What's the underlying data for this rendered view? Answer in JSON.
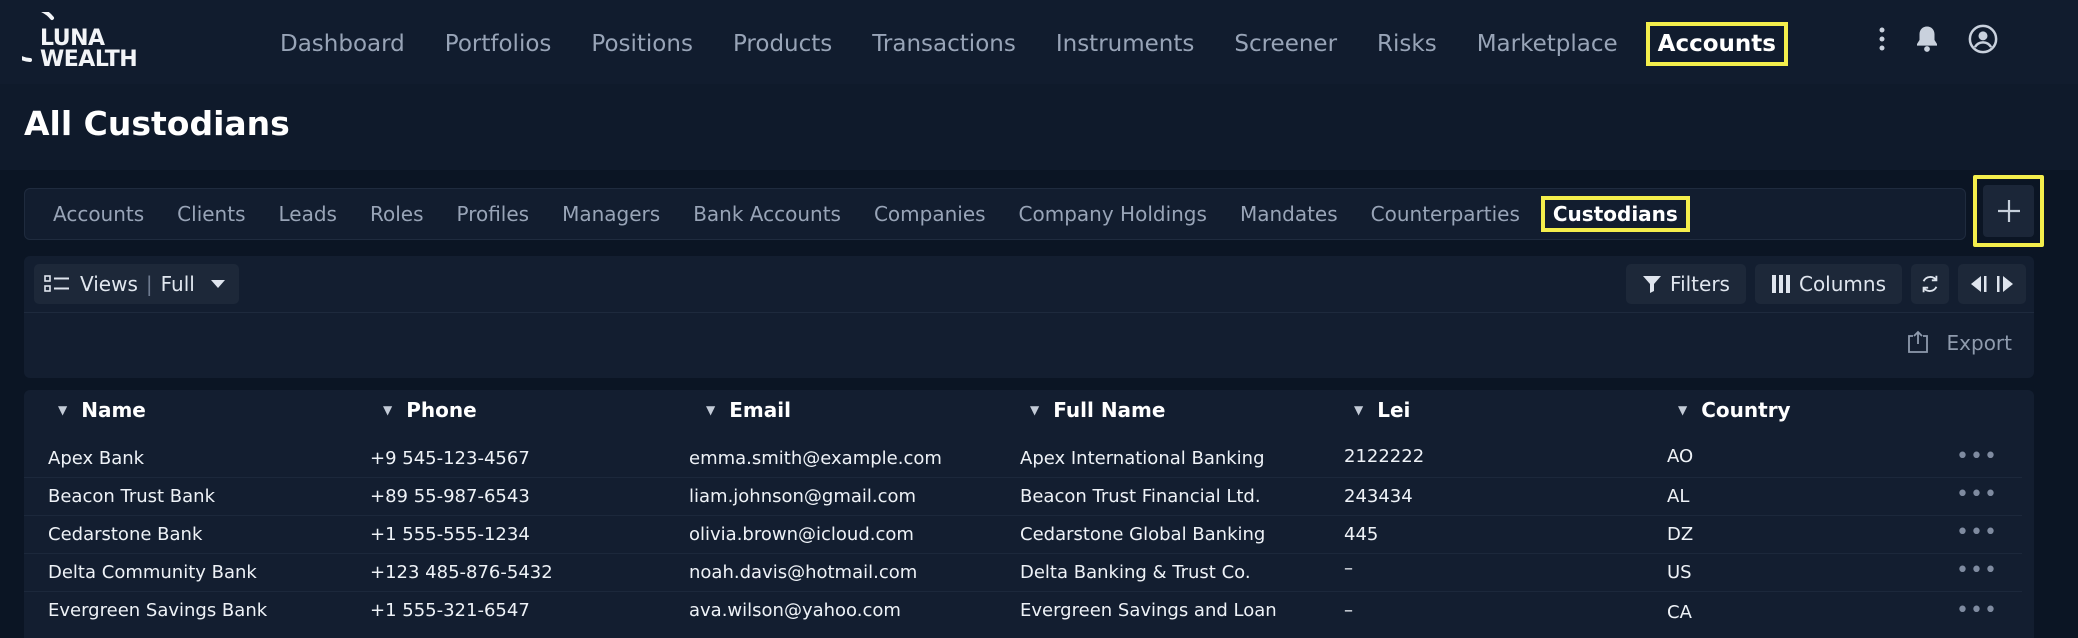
{
  "brand": {
    "line1": "LUNA",
    "line2": "WEALTH"
  },
  "nav": {
    "items": [
      {
        "label": "Dashboard"
      },
      {
        "label": "Portfolios"
      },
      {
        "label": "Positions"
      },
      {
        "label": "Products"
      },
      {
        "label": "Transactions"
      },
      {
        "label": "Instruments"
      },
      {
        "label": "Screener"
      },
      {
        "label": "Risks"
      },
      {
        "label": "Marketplace"
      },
      {
        "label": "Accounts",
        "active": true
      }
    ],
    "icons": [
      "more-vertical-icon",
      "bell-icon",
      "user-circle-icon"
    ]
  },
  "page": {
    "title": "All Custodians"
  },
  "subtabs": {
    "items": [
      {
        "label": "Accounts"
      },
      {
        "label": "Clients"
      },
      {
        "label": "Leads"
      },
      {
        "label": "Roles"
      },
      {
        "label": "Profiles"
      },
      {
        "label": "Managers"
      },
      {
        "label": "Bank Accounts"
      },
      {
        "label": "Companies"
      },
      {
        "label": "Company Holdings"
      },
      {
        "label": "Mandates"
      },
      {
        "label": "Counterparties"
      },
      {
        "label": "Custodians",
        "active": true
      }
    ],
    "add_icon": "plus-icon"
  },
  "toolbar": {
    "views_label": "Views",
    "views_value": "Full",
    "filters_label": "Filters",
    "columns_label": "Columns",
    "export_label": "Export"
  },
  "table": {
    "columns": [
      "Name",
      "Phone",
      "Email",
      "Full Name",
      "Lei",
      "Country"
    ],
    "rows": [
      [
        "Apex Bank",
        "+9 545-123-4567",
        "emma.smith@example.com",
        "Apex International Banking",
        "2122222",
        "AO"
      ],
      [
        "Beacon Trust Bank",
        "+89 55-987-6543",
        "liam.johnson@gmail.com",
        "Beacon Trust Financial Ltd.",
        "243434",
        "AL"
      ],
      [
        "Cedarstone Bank",
        "+1 555-555-1234",
        "olivia.brown@icloud.com",
        "Cedarstone Global Banking",
        "445",
        "DZ"
      ],
      [
        "Delta Community Bank",
        "+123 485-876-5432",
        "noah.davis@hotmail.com",
        "Delta Banking & Trust Co.",
        "–",
        "US"
      ],
      [
        "Evergreen Savings Bank",
        "+1 555-321-6547",
        "ava.wilson@yahoo.com",
        "Evergreen Savings and Loan",
        "–",
        "CA"
      ]
    ],
    "row_action": "•••"
  },
  "colors": {
    "highlight": "#f4ee4c",
    "background": "#0f1a2b",
    "panel": "#131e30"
  }
}
